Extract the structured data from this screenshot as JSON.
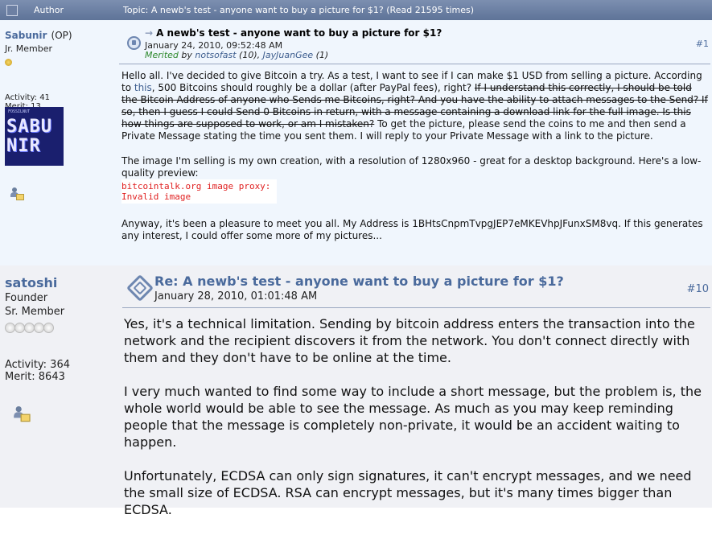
{
  "header": {
    "author_label": "Author",
    "topic_line": "Topic: A newb's test - anyone want to buy a picture for $1?  (Read 21595 times)"
  },
  "posts": [
    {
      "author": "Sabunir",
      "op_tag": "(OP)",
      "rank": "Jr. Member",
      "activity": "Activity: 41",
      "merit": "Merit: 13",
      "avatar_text": {
        "top": "FOSSILNUT",
        "line1": "SABU",
        "line2": "NIR"
      },
      "title": "A newb's test - anyone want to buy a picture for $1?",
      "date": "January 24, 2010, 09:52:48 AM",
      "merited": {
        "label": "Merited",
        "by": "by",
        "user1": "notsofast",
        "count1": "(10)",
        "sep": ",",
        "user2": "JayJuanGee",
        "count2": "(1)"
      },
      "number": "#1",
      "body": {
        "p1_a": "Hello all. I've decided to give Bitcoin a try. As a test, I want to see if I can make $1 USD from selling a picture. According to ",
        "p1_link": "this",
        "p1_b": ", 500 Bitcoins should roughly be a dollar (after PayPal fees), right? ",
        "p1_struck": "If I understand this correctly, I should be told the Bitcoin Address of anyone who Sends me Bitcoins, right? And you have the ability to attach messages to the Send? If so, then I guess I could Send 0 Bitcoins in return, with a message containing a download link for the full image. Is this how things are supposed to work, or am I mistaken?",
        "p1_c": " To get the picture, please send the coins to me and then send a Private Message stating the time you sent them. I will reply to your Private Message with a link to the picture.",
        "p2": "The image I'm selling is my own creation, with a resolution of 1280x960 - great for a desktop background. Here's a low-quality preview:",
        "proxy_line1": "bitcointalk.org image proxy:",
        "proxy_line2": "Invalid image",
        "p3": "Anyway, it's been a pleasure to meet you all. My Address is 1BHtsCnpmTvpgJEP7eMKEVhpJFunxSM8vq. If this generates any interest, I could offer some more of my pictures..."
      }
    },
    {
      "author": "satoshi",
      "rank": "Founder",
      "rank2": "Sr. Member",
      "activity": "Activity: 364",
      "merit": "Merit: 8643",
      "title": "Re: A newb's test - anyone want to buy a picture for $1?",
      "date": "January 28, 2010, 01:01:48 AM",
      "number": "#10",
      "body": {
        "p1": "Yes, it's a technical limitation.  Sending by bitcoin address enters the transaction into the network and the recipient discovers it from the network.  You don't connect directly with them and they don't have to be online at the time.",
        "p2": "I very much wanted to find some way to include a short message, but the problem is, the whole world would be able to see the message.  As much as you may keep reminding people that the message is completely non-private, it would be an accident waiting to happen.",
        "p3": "Unfortunately, ECDSA can only sign signatures, it can't encrypt messages, and we need the small size of ECDSA.  RSA can encrypt messages, but it's many times bigger than ECDSA."
      }
    }
  ],
  "colors": {
    "header_bar": "#6b7fa3",
    "name": "#4a6a9c",
    "merited": "#2f8a2f",
    "proxy_error": "#e02020"
  }
}
